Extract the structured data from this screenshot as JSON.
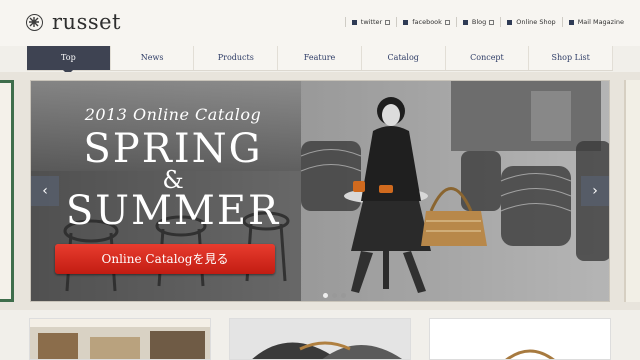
{
  "brand": {
    "name": "russet"
  },
  "utility_links": [
    {
      "label": "twitter",
      "external": true
    },
    {
      "label": "facebook",
      "external": true
    },
    {
      "label": "Blog",
      "external": true
    },
    {
      "label": "Online Shop",
      "external": false
    },
    {
      "label": "Mail Magazine",
      "external": false
    }
  ],
  "nav": {
    "tabs": [
      "Top",
      "News",
      "Products",
      "Feature",
      "Catalog",
      "Concept",
      "Shop List"
    ],
    "active": "Top"
  },
  "hero": {
    "catalog_line": "2013 Online Catalog",
    "line1": "SPRING",
    "amp": "&",
    "line2": "SUMMER",
    "cta": "Online Catalogを見る",
    "prev": "‹",
    "next": "›",
    "slide_count": 3,
    "active_slide": 1
  },
  "colors": {
    "nav_active": "#3e4352",
    "nav_text": "#2f3d67",
    "cta": "#d62a1e",
    "side_green": "#3e6d4b"
  }
}
